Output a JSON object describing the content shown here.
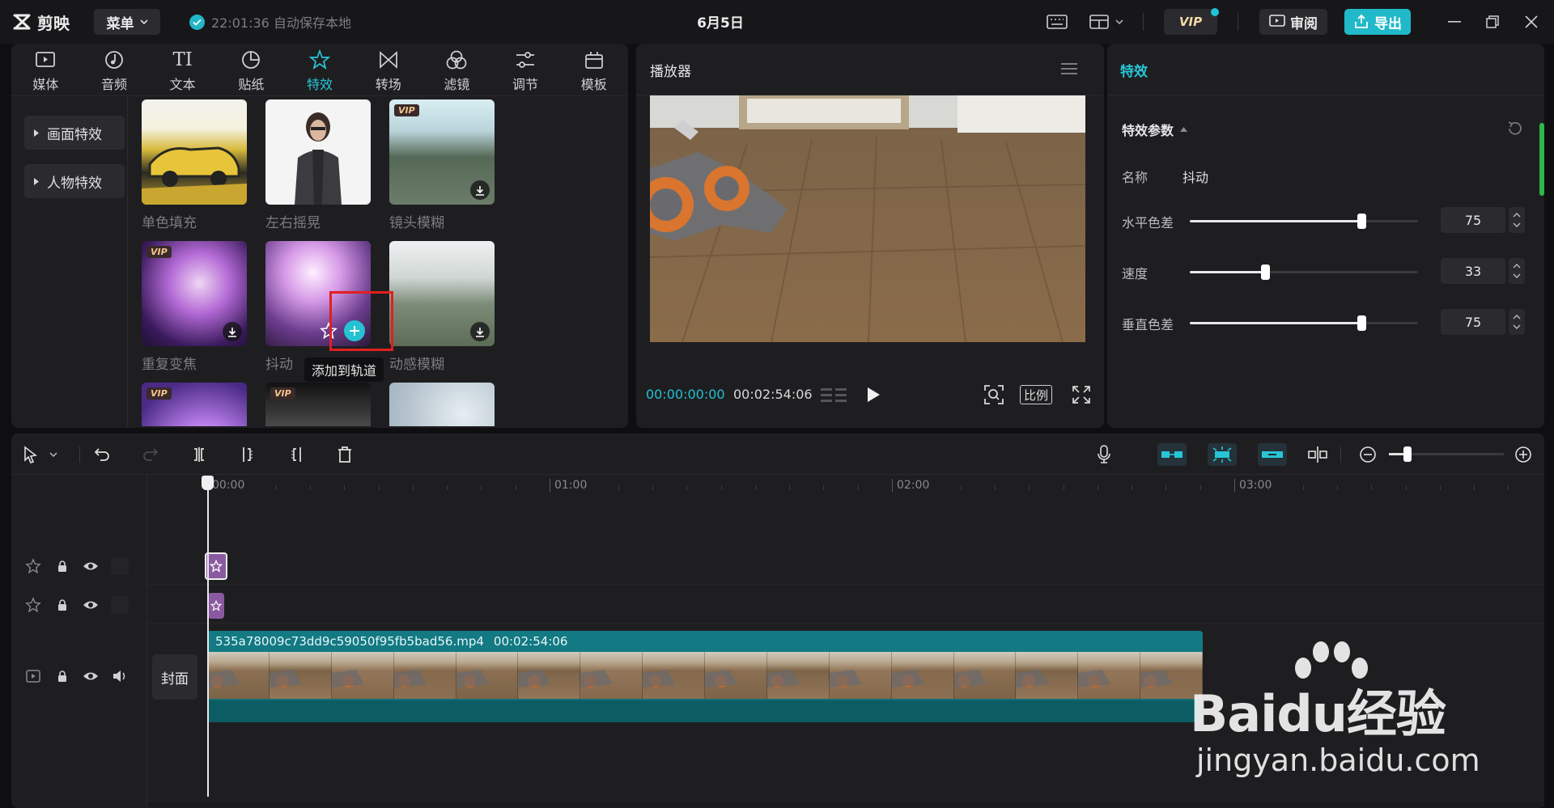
{
  "app": {
    "logo_text": "剪映",
    "menu_label": "菜单",
    "autosave_text": "22:01:36 自动保存本地",
    "project_title": "6月5日",
    "vip_label": "VIP",
    "review_label": "审阅",
    "export_label": "导出"
  },
  "toolbar": {
    "tabs": [
      {
        "label": "媒体",
        "icon": "media-icon"
      },
      {
        "label": "音频",
        "icon": "audio-icon"
      },
      {
        "label": "文本",
        "icon": "text-icon"
      },
      {
        "label": "贴纸",
        "icon": "sticker-icon"
      },
      {
        "label": "特效",
        "icon": "effects-icon",
        "active": true
      },
      {
        "label": "转场",
        "icon": "transition-icon"
      },
      {
        "label": "滤镜",
        "icon": "filter-icon"
      },
      {
        "label": "调节",
        "icon": "adjust-icon"
      },
      {
        "label": "模板",
        "icon": "template-icon"
      }
    ],
    "text_tab_glyph": "TI"
  },
  "categories": [
    "画面特效",
    "人物特效"
  ],
  "effects": [
    {
      "label": "单色填充",
      "vip": false,
      "download": false
    },
    {
      "label": "左右摇晃",
      "vip": false,
      "download": false
    },
    {
      "label": "镜头模糊",
      "vip": true,
      "download": true
    },
    {
      "label": "重复变焦",
      "vip": true,
      "download": true
    },
    {
      "label": "抖动",
      "vip": false,
      "download": false
    },
    {
      "label": "动感模糊",
      "vip": false,
      "download": true
    },
    {
      "label": "",
      "vip": true,
      "download": false
    },
    {
      "label": "",
      "vip": true,
      "download": false
    },
    {
      "label": "",
      "vip": false,
      "download": false
    }
  ],
  "vip_tag": "VIP",
  "tooltip": "添加到轨道",
  "player": {
    "title": "播放器",
    "current_time": "00:00:00:00",
    "total_time": "00:02:54:06",
    "ratio_label": "比例"
  },
  "properties": {
    "title": "特效",
    "section_title": "特效参数",
    "name_label": "名称",
    "name_value": "抖动",
    "params": [
      {
        "label": "水平色差",
        "value": "75",
        "fraction": 0.75
      },
      {
        "label": "速度",
        "value": "33",
        "fraction": 0.33
      },
      {
        "label": "垂直色差",
        "value": "75",
        "fraction": 0.75
      }
    ]
  },
  "timeline": {
    "ruler_labels": [
      "00:00",
      "01:00",
      "02:00",
      "03:00"
    ],
    "cover_label": "封面",
    "clip_name": "535a78009c73dd9c59050f95fb5bad56.mp4",
    "clip_duration": "00:02:54:06",
    "zoom_fraction": 0.16
  },
  "watermark": {
    "main": "Baidu经验",
    "sub": "jingyan.baidu.com"
  },
  "colors": {
    "accent": "#21b9c9",
    "highlight_box": "#e0201f",
    "effect_clip": "#8a5aa0",
    "video_clip": "#0f6f78"
  }
}
